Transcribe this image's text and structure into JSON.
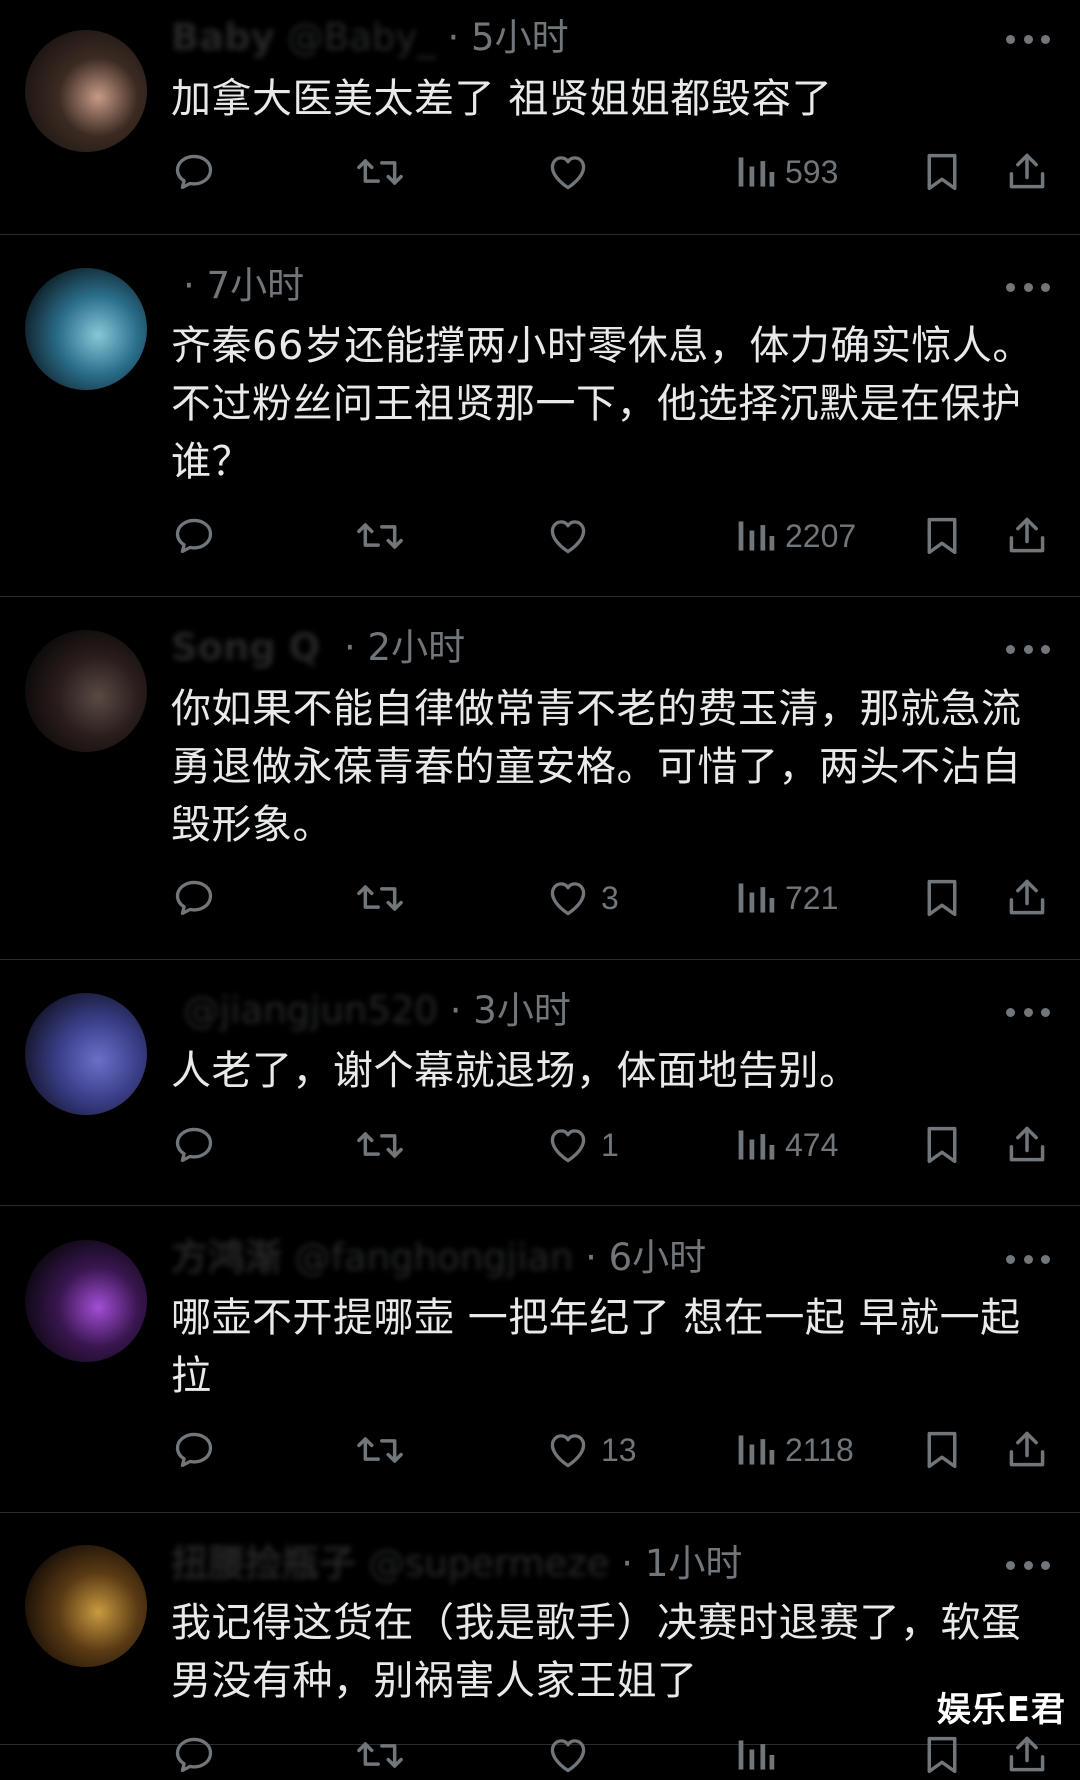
{
  "tweets": [
    {
      "name": "Baby",
      "handle": "@Baby_",
      "time": "5小时",
      "text": "加拿大医美太差了 祖贤姐姐都毁容了",
      "replies": "",
      "retweets": "",
      "likes": "",
      "views": "593",
      "avatar_colors": [
        "#1a1412",
        "#3b2a22",
        "#c79a86"
      ]
    },
    {
      "name": "",
      "handle": "",
      "time": "7小时",
      "text": "齐秦66岁还能撑两小时零休息，体力确实惊人。不过粉丝问王祖贤那一下，他选择沉默是在保护谁？",
      "replies": "",
      "retweets": "",
      "likes": "",
      "views": "2207",
      "avatar_colors": [
        "#0e1a22",
        "#2a6e8a",
        "#8ac6d8"
      ]
    },
    {
      "name": "Song Q",
      "handle": "",
      "time": "2小时",
      "text": "你如果不能自律做常青不老的费玉清，那就急流勇退做永葆青春的童安格。可惜了，两头不沾自毁形象。",
      "replies": "",
      "retweets": "",
      "likes": "3",
      "views": "721",
      "avatar_colors": [
        "#0a0808",
        "#2a1e1c",
        "#5a4a44"
      ]
    },
    {
      "name": "",
      "handle": "@jiangjun520",
      "time": "3小时",
      "text": "人老了，谢个幕就退场，体面地告别。",
      "replies": "",
      "retweets": "",
      "likes": "1",
      "views": "474",
      "avatar_colors": [
        "#121426",
        "#3b3f8a",
        "#6a70c8"
      ]
    },
    {
      "name": "方鸿渐",
      "handle": "@fanghongjian",
      "time": "6小时",
      "text": "哪壶不开提哪壶 一把年纪了 想在一起 早就一起拉",
      "replies": "",
      "retweets": "",
      "likes": "13",
      "views": "2118",
      "avatar_colors": [
        "#08060c",
        "#3a1650",
        "#a24ed6"
      ]
    },
    {
      "name": "扭腰捡瓶子",
      "handle": "@supermeze",
      "time": "1小时",
      "text": "我记得这货在（我是歌手）决赛时退赛了，软蛋男没有种，别祸害人家王姐了",
      "replies": "",
      "retweets": "",
      "likes": "",
      "views": "",
      "avatar_colors": [
        "#140c06",
        "#5a3a14",
        "#c89a40"
      ]
    }
  ],
  "watermark": "娱乐E君"
}
